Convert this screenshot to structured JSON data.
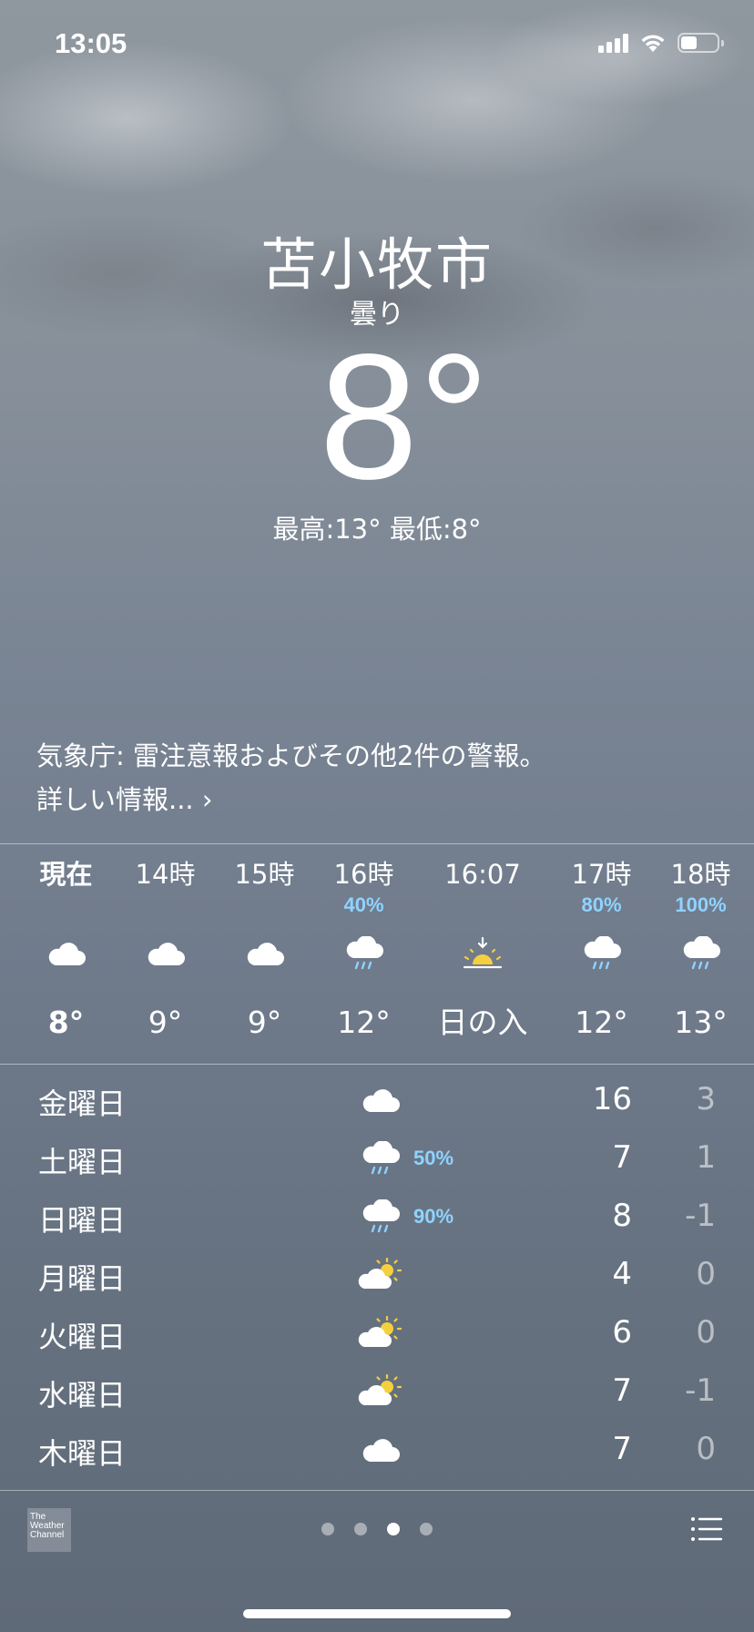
{
  "status_bar": {
    "time": "13:05"
  },
  "location": {
    "city": "苫小牧市",
    "condition": "曇り",
    "temperature": "8°",
    "high_low": "最高:13° 最低:8°"
  },
  "alert": {
    "text": "気象庁: 雷注意報およびその他2件の警報。",
    "more": "詳しい情報... ›"
  },
  "hourly": [
    {
      "label": "現在",
      "pop": "",
      "icon": "cloud-icon",
      "temp": "8°",
      "bold": true
    },
    {
      "label": "14時",
      "pop": "",
      "icon": "cloud-icon",
      "temp": "9°"
    },
    {
      "label": "15時",
      "pop": "",
      "icon": "cloud-icon",
      "temp": "9°"
    },
    {
      "label": "16時",
      "pop": "40%",
      "icon": "rain-cloud-icon",
      "temp": "12°"
    },
    {
      "label": "16:07",
      "pop": "",
      "icon": "sunset-icon",
      "temp": "日の入"
    },
    {
      "label": "17時",
      "pop": "80%",
      "icon": "rain-cloud-icon",
      "temp": "12°"
    },
    {
      "label": "18時",
      "pop": "100%",
      "icon": "rain-cloud-icon",
      "temp": "13°"
    }
  ],
  "daily": [
    {
      "day": "金曜日",
      "icon": "cloud-icon",
      "pop": "",
      "high": "16",
      "low": "3"
    },
    {
      "day": "土曜日",
      "icon": "rain-cloud-icon",
      "pop": "50%",
      "high": "7",
      "low": "1"
    },
    {
      "day": "日曜日",
      "icon": "rain-cloud-icon",
      "pop": "90%",
      "high": "8",
      "low": "-1"
    },
    {
      "day": "月曜日",
      "icon": "partly-sunny-icon",
      "pop": "",
      "high": "4",
      "low": "0"
    },
    {
      "day": "火曜日",
      "icon": "partly-sunny-icon",
      "pop": "",
      "high": "6",
      "low": "0"
    },
    {
      "day": "水曜日",
      "icon": "partly-sunny-icon",
      "pop": "",
      "high": "7",
      "low": "-1"
    },
    {
      "day": "木曜日",
      "icon": "cloud-icon",
      "pop": "",
      "high": "7",
      "low": "0"
    }
  ],
  "footer": {
    "provider_logo": "The Weather Channel",
    "page_count": 4,
    "active_page": 3
  },
  "colors": {
    "precip_blue": "#8fd3ff",
    "sun_yellow": "#f6cf3f"
  }
}
